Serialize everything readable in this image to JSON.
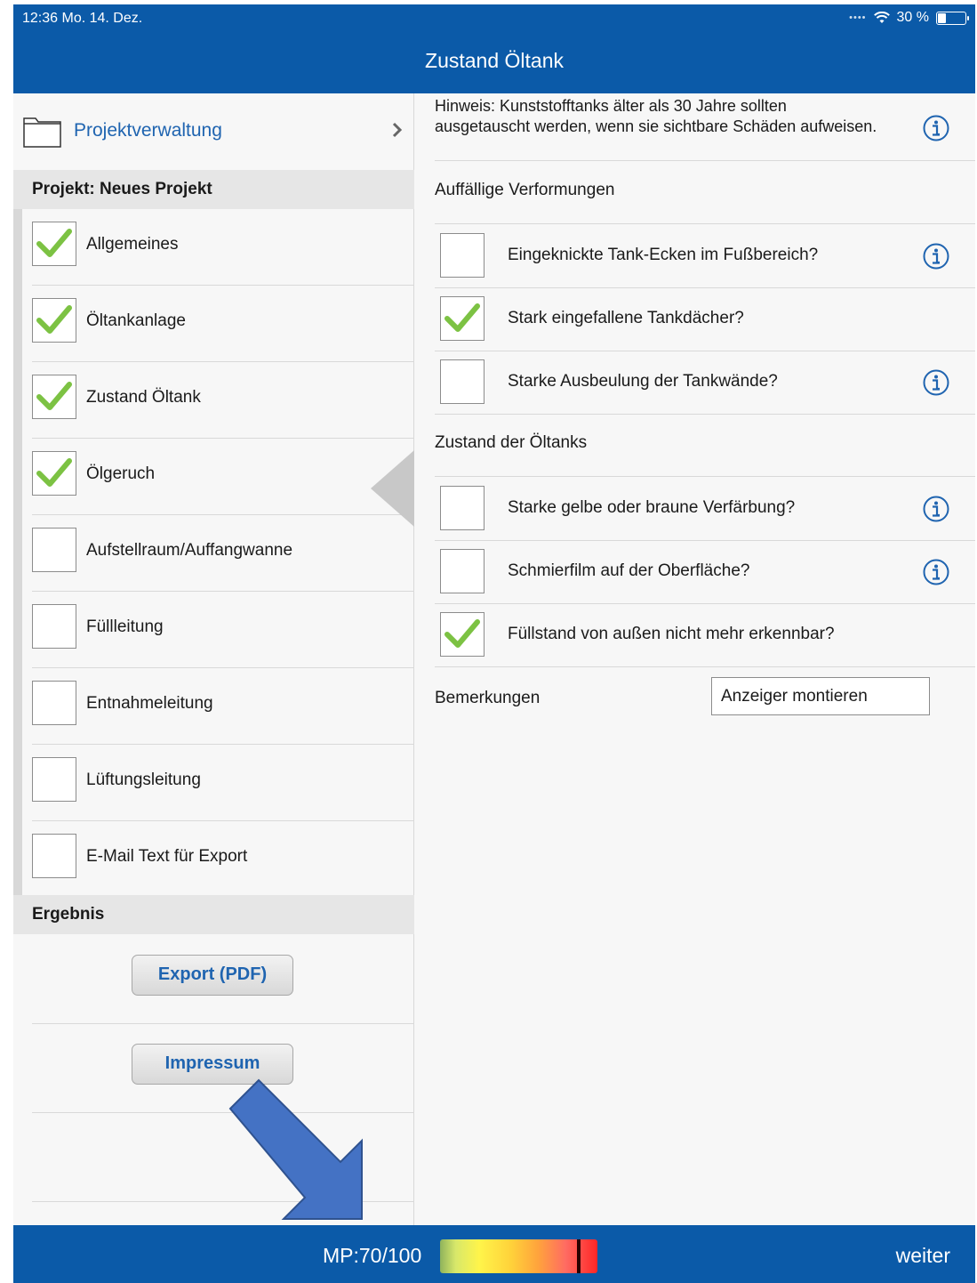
{
  "status_bar": {
    "time_date": "12:36  Mo. 14. Dez.",
    "battery_text": "30 %",
    "battery_level": 0.3
  },
  "header": {
    "title": "Zustand Öltank"
  },
  "sidebar": {
    "project_management": "Projektverwaltung",
    "project_header": "Projekt: Neues Projekt",
    "items": [
      {
        "label": "Allgemeines",
        "checked": true
      },
      {
        "label": "Öltankanlage",
        "checked": true
      },
      {
        "label": "Zustand Öltank",
        "checked": true,
        "selected": true
      },
      {
        "label": "Ölgeruch",
        "checked": true
      },
      {
        "label": "Aufstellraum/Auffangwanne",
        "checked": false
      },
      {
        "label": "Füllleitung",
        "checked": false
      },
      {
        "label": "Entnahmeleitung",
        "checked": false
      },
      {
        "label": "Lüftungsleitung",
        "checked": false
      },
      {
        "label": "E-Mail Text für Export",
        "checked": false
      }
    ],
    "result_header": "Ergebnis",
    "export_button": "Export (PDF)",
    "imprint_button": "Impressum"
  },
  "main": {
    "hint": "Hinweis: Kunststofftanks älter als 30 Jahre sollten ausgetauscht werden, wenn sie sichtbare Schäden aufweisen.",
    "groups": [
      {
        "title": "Auffällige Verformungen",
        "questions": [
          {
            "label": "Eingeknickte Tank-Ecken im Fußbereich?",
            "checked": false,
            "info": true
          },
          {
            "label": "Stark eingefallene Tankdächer?",
            "checked": true,
            "info": false
          },
          {
            "label": "Starke Ausbeulung der Tankwände?",
            "checked": false,
            "info": true
          }
        ]
      },
      {
        "title": "Zustand der Öltanks",
        "questions": [
          {
            "label": "Starke gelbe oder braune Verfärbung?",
            "checked": false,
            "info": true
          },
          {
            "label": "Schmierfilm auf der Oberfläche?",
            "checked": false,
            "info": true
          },
          {
            "label": "Füllstand von außen nicht mehr erkennbar?",
            "checked": true,
            "info": false
          }
        ]
      }
    ],
    "remarks_label": "Bemerkungen",
    "remarks_value": "Anzeiger montieren"
  },
  "footer": {
    "mp_label": "MP:70/100",
    "mp_value": 70,
    "mp_max": 100,
    "next_label": "weiter"
  },
  "colors": {
    "brand_blue": "#0b5aa8",
    "link_blue": "#1f64b0",
    "check_green": "#7cc243",
    "annotation_arrow": "#4472c4"
  },
  "icons": {
    "folder": "folder-icon",
    "chevron": "chevron-right-icon",
    "check": "checkmark-icon",
    "info": "info-icon",
    "wifi": "wifi-icon",
    "battery": "battery-icon",
    "arrow": "arrow-down-right-icon"
  }
}
